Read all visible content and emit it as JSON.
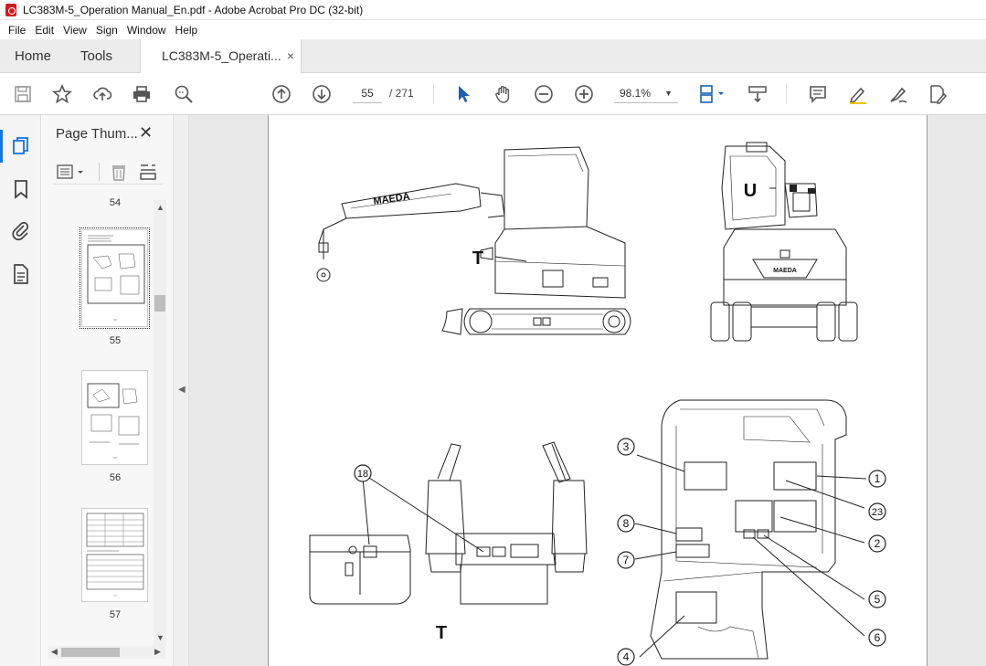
{
  "window": {
    "title": "LC383M-5_Operation Manual_En.pdf - Adobe Acrobat Pro DC (32-bit)"
  },
  "menu": [
    "File",
    "Edit",
    "View",
    "Sign",
    "Window",
    "Help"
  ],
  "tabs": {
    "home": "Home",
    "tools": "Tools",
    "doc": "LC383M-5_Operati...",
    "close": "×"
  },
  "toolbar": {
    "page_current": "55",
    "page_total": "/ 271",
    "zoom": "98.1%"
  },
  "panel": {
    "title": "Page Thum...",
    "close": "✕"
  },
  "thumbnails": [
    {
      "label": "54"
    },
    {
      "label": "55"
    },
    {
      "label": "56"
    },
    {
      "label": "57"
    }
  ],
  "diagram": {
    "letter_t_top": "T",
    "letter_u": "U",
    "letter_t_bottom": "T",
    "brand": "MAEDA",
    "callouts": [
      "18",
      "3",
      "1",
      "23",
      "2",
      "8",
      "7",
      "5",
      "6",
      "4"
    ]
  }
}
